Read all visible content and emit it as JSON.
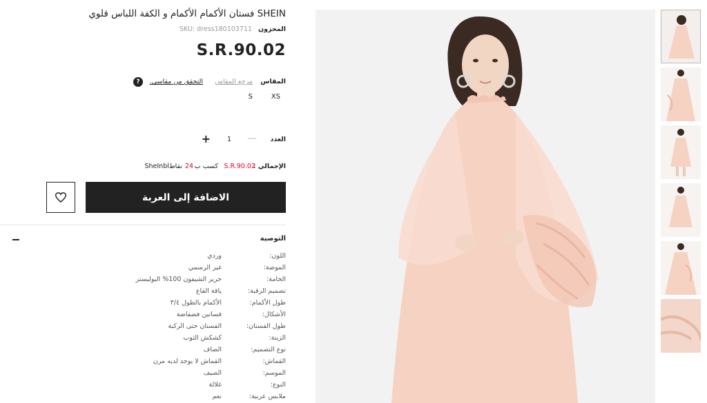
{
  "product": {
    "title": "SHEIN فستان الأكمام الأكمام و الكفة اللباس قلوي",
    "sku_label": "المخزون",
    "sku_value": "SKU: dress180103711",
    "price": "S.R.90.02"
  },
  "size": {
    "label": "المقاس",
    "reference_link": "مرجع المقاس",
    "check_link": "التحقق من مقاسي.",
    "help_icon": "?",
    "options": [
      "XS",
      "S"
    ]
  },
  "quantity": {
    "label": "العدد",
    "value": "1",
    "minus_icon": "—",
    "plus_icon": "+"
  },
  "total": {
    "label": "الإجمالي :",
    "amount": "S.R.90.02",
    "earn_text": "كسب ب",
    "points": "24",
    "points_unit": "نقاطSheInbl"
  },
  "actions": {
    "add_to_cart": "الاضافة إلى العربة",
    "wishlist_icon": "heart-icon"
  },
  "description": {
    "title": "التوصية",
    "collapse_icon": "minus-icon",
    "attributes": [
      {
        "key": "اللون:",
        "value": "وردي"
      },
      {
        "key": "الموضة:",
        "value": "غير الرسمي"
      },
      {
        "key": "الخامة:",
        "value": "حرير الشيفون 100% البوليستر"
      },
      {
        "key": "تصميم الرقبة:",
        "value": "ياقة القاع"
      },
      {
        "key": "طول الأكمام:",
        "value": "الأكمام بالطول ٣/٤"
      },
      {
        "key": "الأشكال:",
        "value": "فساتين فضفاضة"
      },
      {
        "key": "طول الفستان:",
        "value": "الفستان حتى الركبة"
      },
      {
        "key": "الزينة:",
        "value": "كشكش الثوب"
      },
      {
        "key": "نوع التصميم:",
        "value": "الصاف"
      },
      {
        "key": "القماش:",
        "value": "القماش لا يوجد لديه مرن"
      },
      {
        "key": "الموسم:",
        "value": "الصيف"
      },
      {
        "key": "النوع:",
        "value": "غلالة"
      },
      {
        "key": "ملابس عربية:",
        "value": "نعم"
      }
    ]
  },
  "colors": {
    "accent": "#222222",
    "price_red": "#e0002a",
    "dress_pink": "#f6d2c2"
  }
}
